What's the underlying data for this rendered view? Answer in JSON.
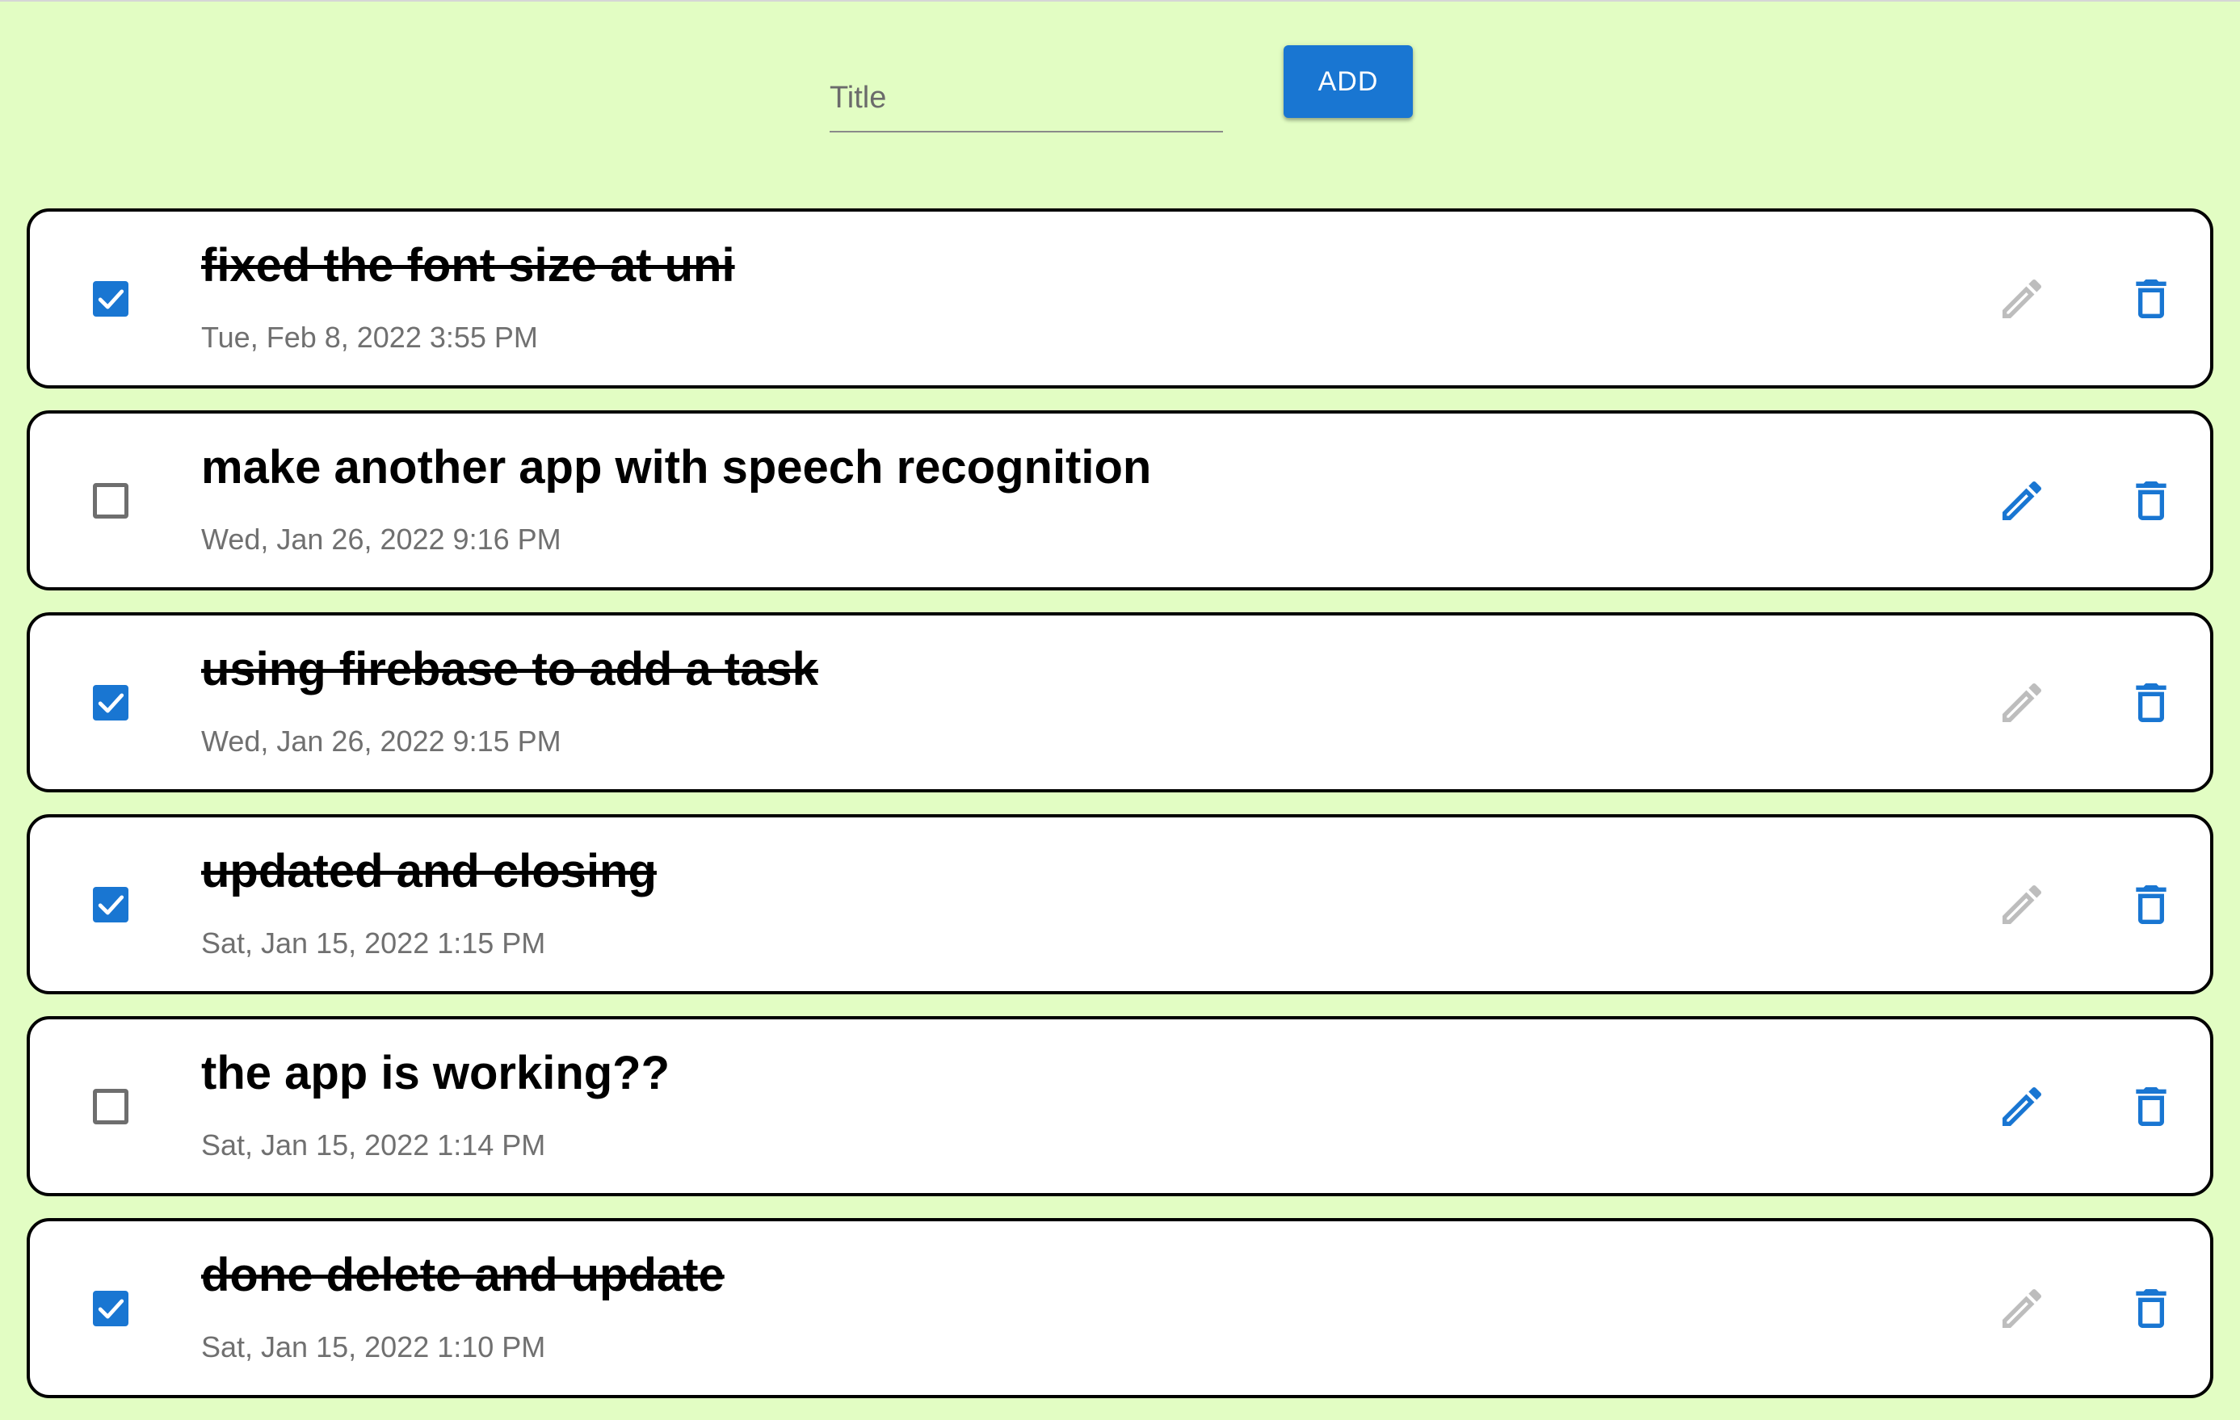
{
  "form": {
    "title_placeholder": "Title",
    "title_value": "",
    "add_label": "ADD"
  },
  "colors": {
    "background": "#e2fdc3",
    "accent": "#1976d2",
    "disabled_icon": "#bdbdbd"
  },
  "tasks": [
    {
      "title": "fixed the font size at uni",
      "date": "Tue, Feb 8, 2022 3:55 PM",
      "completed": true
    },
    {
      "title": "make another app with speech recognition",
      "date": "Wed, Jan 26, 2022 9:16 PM",
      "completed": false
    },
    {
      "title": "using firebase to add a task",
      "date": "Wed, Jan 26, 2022 9:15 PM",
      "completed": true
    },
    {
      "title": "updated and closing",
      "date": "Sat, Jan 15, 2022 1:15 PM",
      "completed": true
    },
    {
      "title": "the app is working??",
      "date": "Sat, Jan 15, 2022 1:14 PM",
      "completed": false
    },
    {
      "title": "done delete and update",
      "date": "Sat, Jan 15, 2022 1:10 PM",
      "completed": true
    }
  ],
  "icons": {
    "checkbox_checked": "check-icon",
    "edit": "pencil-icon",
    "delete": "trash-icon"
  }
}
